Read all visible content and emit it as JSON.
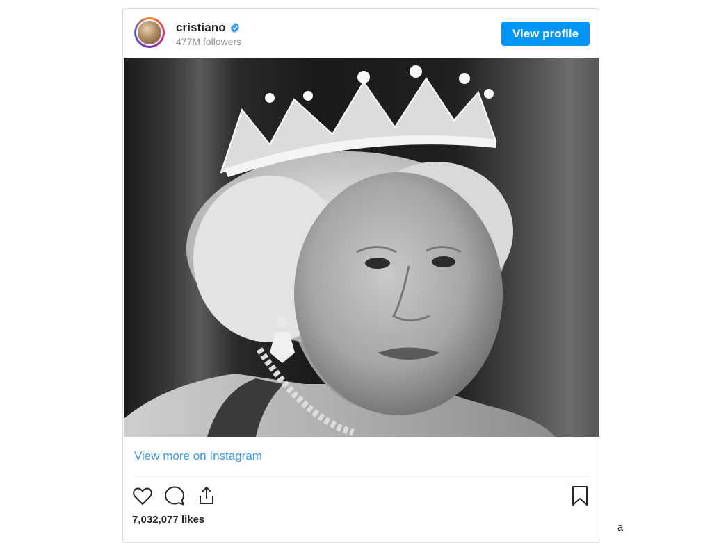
{
  "post": {
    "username": "cristiano",
    "verified": true,
    "followers": "477M followers",
    "view_profile_label": "View profile",
    "view_more_label": "View more on Instagram",
    "likes": "7,032,077 likes"
  },
  "icons": {
    "verified": "verified-badge-icon",
    "like": "heart-icon",
    "comment": "comment-bubble-icon",
    "share": "share-upload-icon",
    "save": "bookmark-icon"
  },
  "colors": {
    "primary_button": "#0095f6",
    "link": "#3897f0",
    "verified": "#3897f0",
    "text": "#262626",
    "muted": "#8e8e8e"
  },
  "page_stray_text": "a"
}
